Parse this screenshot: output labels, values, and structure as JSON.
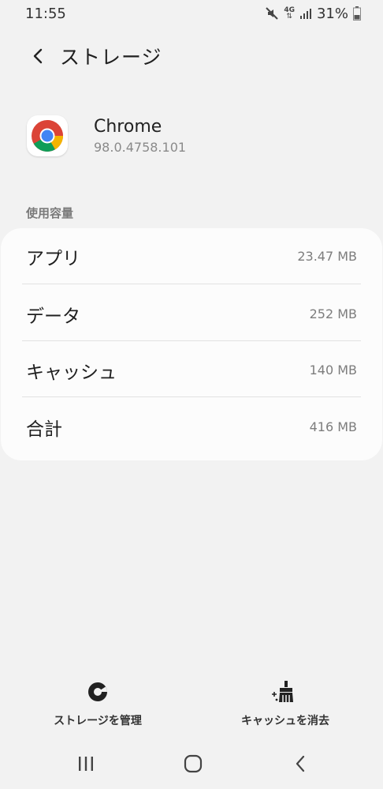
{
  "status_bar": {
    "time": "11:55",
    "network": "4G",
    "battery": "31%"
  },
  "header": {
    "title": "ストレージ"
  },
  "app": {
    "name": "Chrome",
    "version": "98.0.4758.101",
    "icon": "chrome-icon"
  },
  "storage": {
    "section_label": "使用容量",
    "rows": [
      {
        "label": "アプリ",
        "value": "23.47 MB"
      },
      {
        "label": "データ",
        "value": "252 MB"
      },
      {
        "label": "キャッシュ",
        "value": "140 MB"
      },
      {
        "label": "合計",
        "value": "416 MB"
      }
    ]
  },
  "actions": {
    "manage_storage": "ストレージを管理",
    "clear_cache": "キャッシュを消去"
  },
  "colors": {
    "background": "#f2f2f2",
    "card": "#fcfcfc",
    "chrome_red": "#db4437",
    "chrome_green": "#0f9d58",
    "chrome_yellow": "#f4b400",
    "chrome_blue": "#4285f4"
  }
}
